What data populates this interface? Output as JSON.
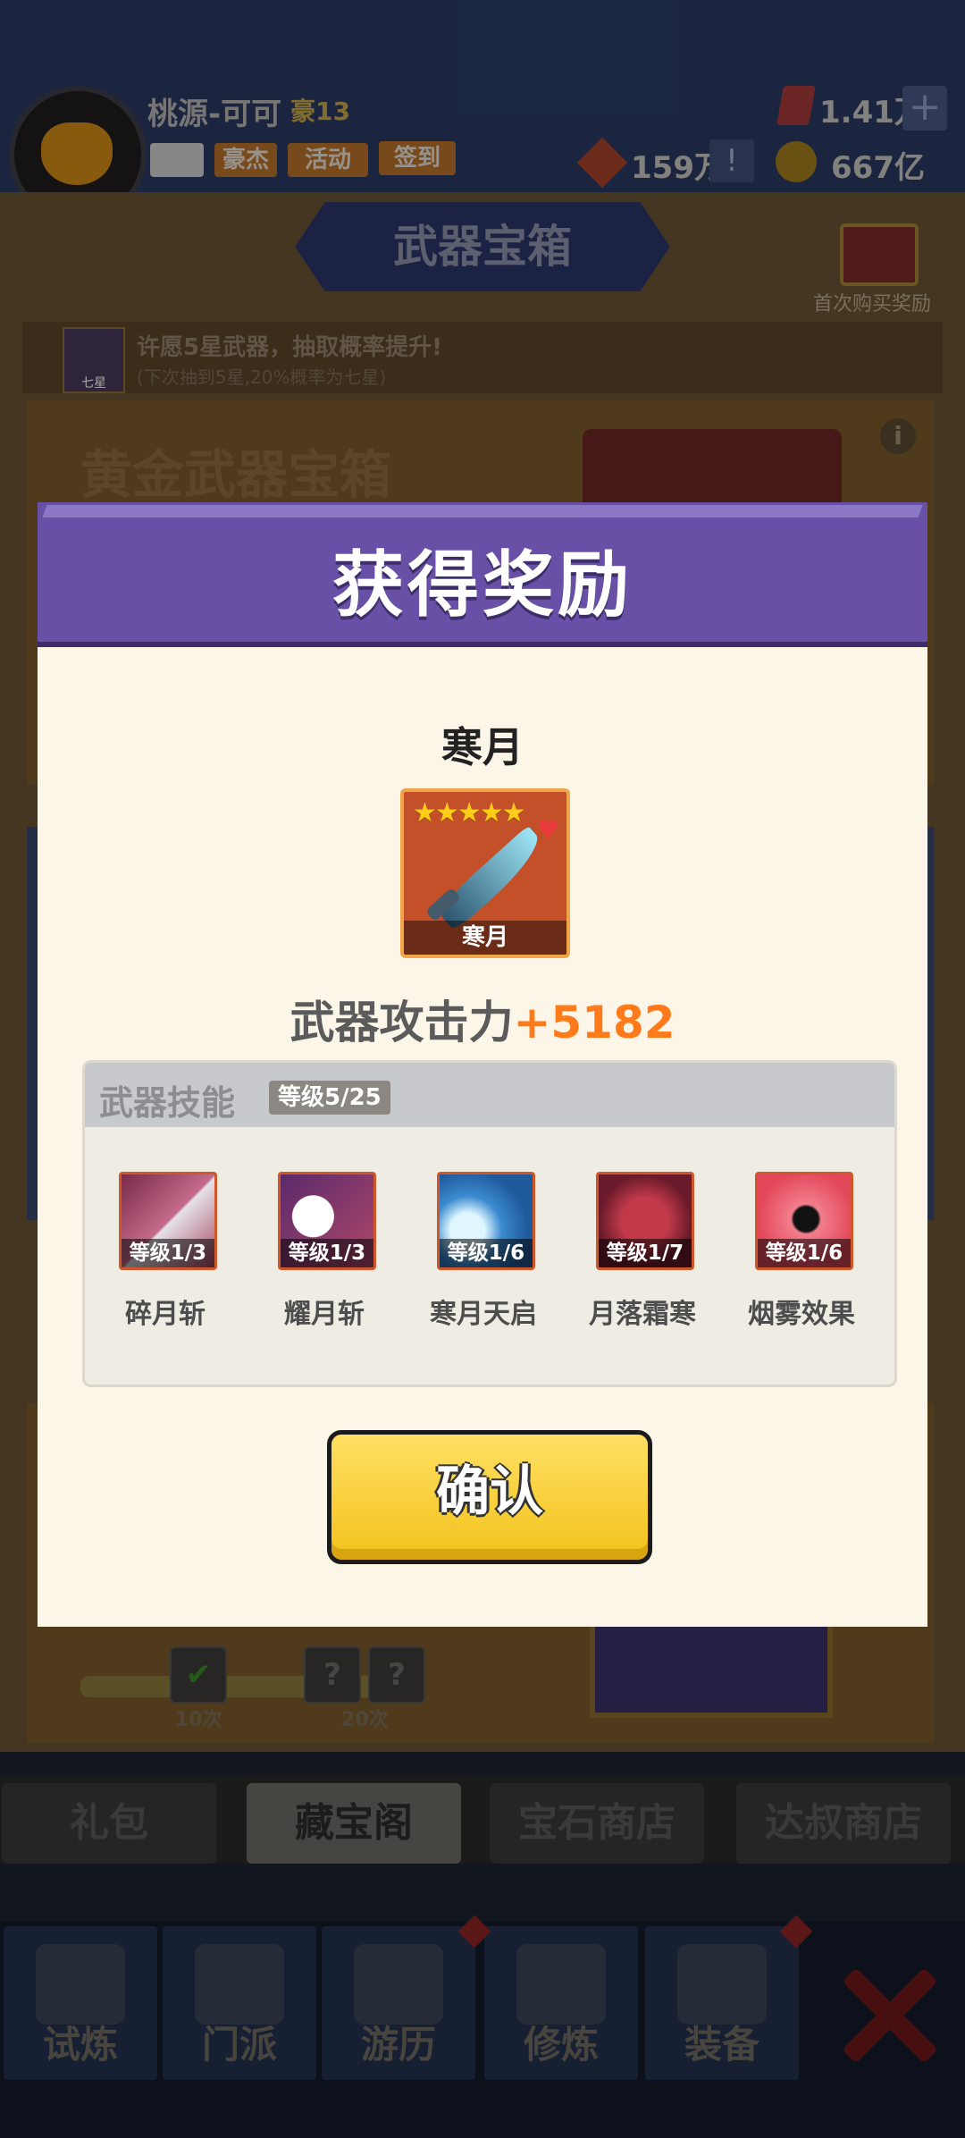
{
  "player": {
    "name": "桃源-可可",
    "rank": "豪13",
    "chips": [
      "豪杰",
      "活动",
      "签到"
    ]
  },
  "resources": {
    "gems": "1.41万",
    "tokens": "159万",
    "coins": "667亿"
  },
  "background": {
    "title": "武器宝箱",
    "first_buy": "首次购买奖励",
    "wish_text": "许愿5星武器，抽取概率提升!",
    "wish_sub": "(下次抽到5星,20%概率为七星)",
    "wish_icon_label": "七星",
    "gold_title": "黄金武器宝箱",
    "progress_labels": [
      "10次",
      "20次"
    ],
    "tabs": [
      "礼包",
      "藏宝阁",
      "宝石商店",
      "达叔商店"
    ],
    "nav": [
      "试炼",
      "门派",
      "游历",
      "修炼",
      "装备"
    ]
  },
  "modal": {
    "title": "获得奖励",
    "weapon_name": "寒月",
    "card_label": "寒月",
    "stars": "★★★★★",
    "attack_label": "武器攻击力",
    "attack_value": "+5182",
    "skills_title": "武器技能",
    "skills_level": "等级5/25",
    "skills": [
      {
        "name": "碎月斩",
        "level": "等级1/3"
      },
      {
        "name": "耀月斩",
        "level": "等级1/3"
      },
      {
        "name": "寒月天启",
        "level": "等级1/6"
      },
      {
        "name": "月落霜寒",
        "level": "等级1/7"
      },
      {
        "name": "烟雾效果",
        "level": "等级1/6"
      }
    ],
    "confirm": "确认"
  }
}
